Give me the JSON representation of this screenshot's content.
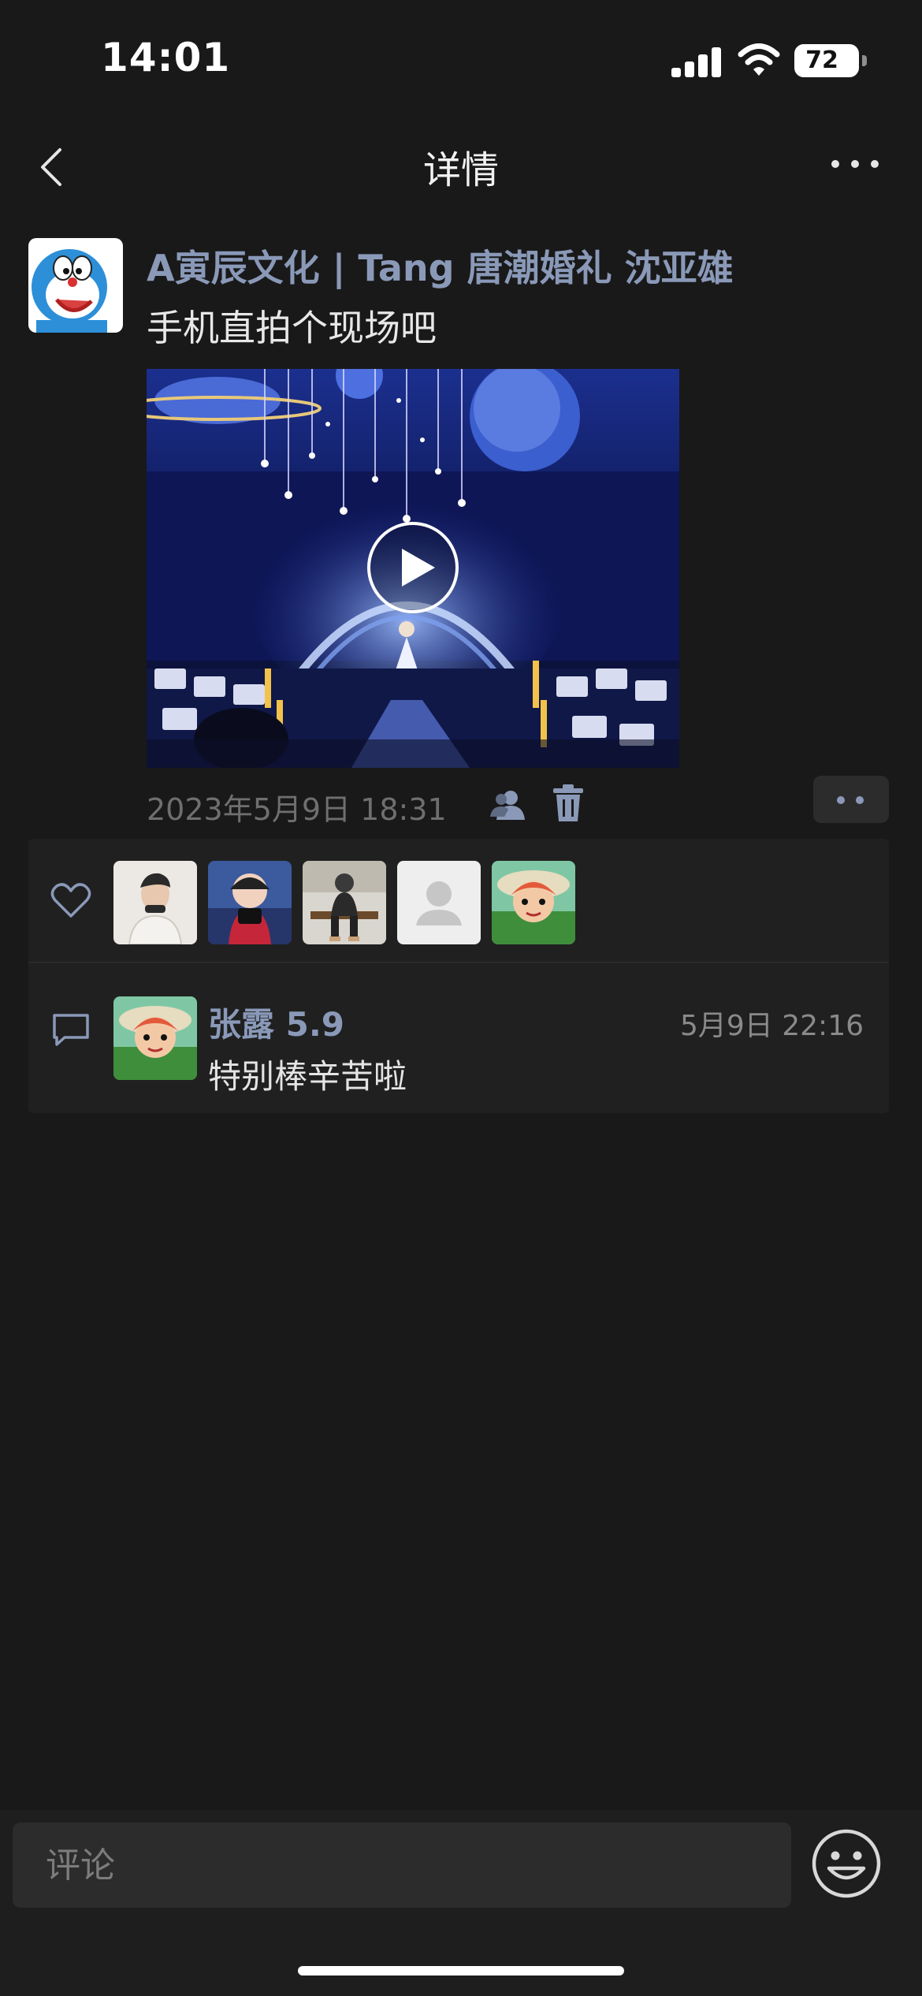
{
  "status_bar": {
    "time": "14:01",
    "battery": "72"
  },
  "nav": {
    "title": "详情",
    "back_icon": "chevron-left-icon",
    "more_icon": "more-horizontal-icon"
  },
  "post": {
    "author": "A寅辰文化 | Tang 唐潮婚礼 沈亚雄",
    "text": "手机直拍个现场吧",
    "timestamp": "2023年5月9日 18:31",
    "media_type": "video"
  },
  "likes": {
    "count_shown": 5
  },
  "comments": [
    {
      "name": "张露 5.9",
      "time": "5月9日 22:16",
      "text": "特别棒辛苦啦"
    }
  ],
  "input": {
    "placeholder": "评论"
  },
  "colors": {
    "background": "#191919",
    "name_accent": "#8a99b8",
    "panel": "#202020"
  }
}
